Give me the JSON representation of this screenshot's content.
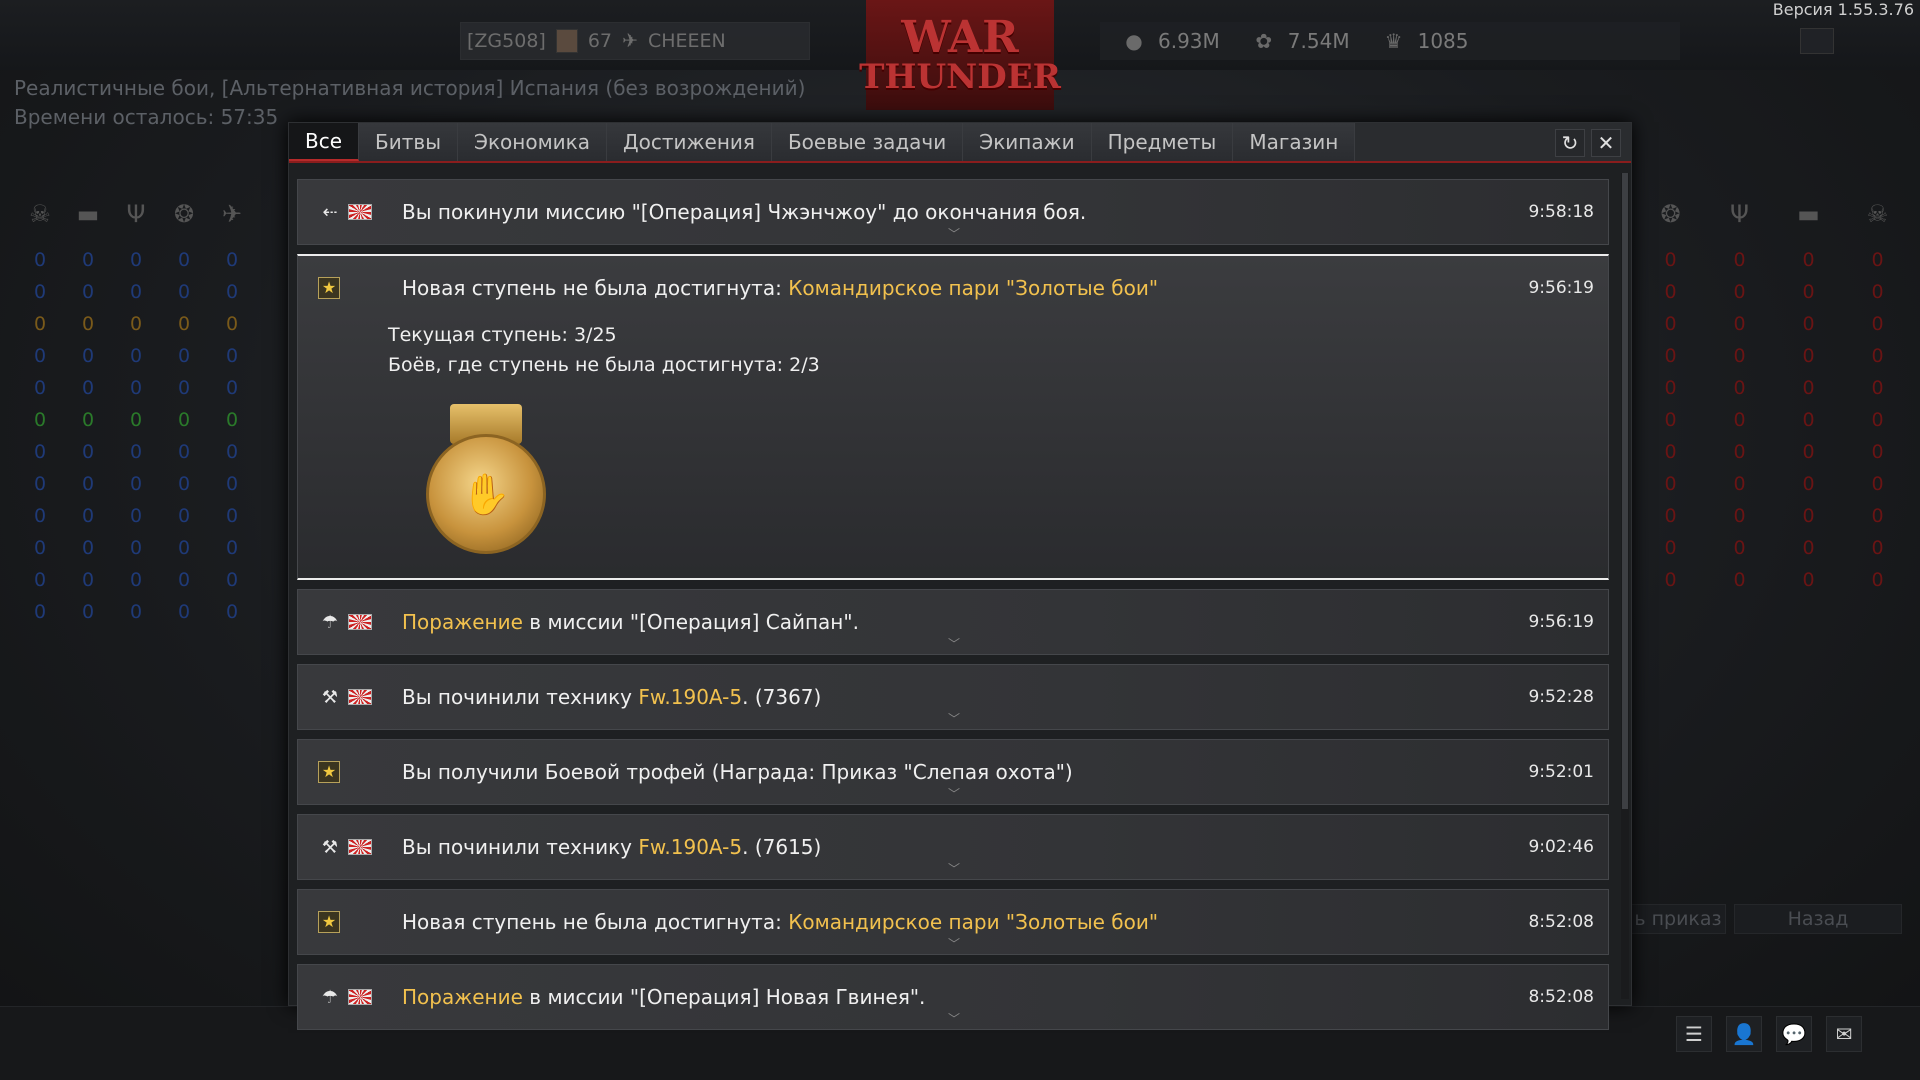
{
  "topbar": {
    "version": "Версия 1.55.3.76",
    "clan_tag": "[ZG508]",
    "level": "67",
    "player_name": "CHEEEN",
    "logo_line1": "WAR",
    "logo_line2": "THUNDER",
    "currencies": [
      {
        "icon": "silver-lions-icon",
        "value": "6.93M"
      },
      {
        "icon": "research-points-icon",
        "value": "7.54M"
      },
      {
        "icon": "golden-eagles-icon",
        "value": "1085"
      }
    ]
  },
  "mission": {
    "line1": "Реалистичные бои, [Альтернативная история]  Испания (без возрождений)",
    "line2": "Времени осталось: 57:35"
  },
  "tabs": [
    "Все",
    "Битвы",
    "Экономика",
    "Достижения",
    "Боевые задачи",
    "Экипажи",
    "Предметы",
    "Магазин"
  ],
  "active_tab": "Все",
  "notifications": [
    {
      "icon": "leave-icon",
      "flag": true,
      "parts": [
        "Вы покинули миссию \"[Операция] Чжэнчжоу\" до окончания боя.",
        "",
        ""
      ],
      "time": "9:58:18"
    },
    {
      "icon": "star-icon",
      "flag": false,
      "parts": [
        "Новая ступень не была достигнута: ",
        "Командирское пари \"Золотые бои\"",
        ""
      ],
      "time": "9:56:19",
      "expanded": true,
      "details": [
        "Текущая ступень: 3/25",
        "Боёв, где ступень не была достигнута: 2/3"
      ]
    },
    {
      "icon": "parachute-icon",
      "flag": true,
      "parts": [
        "",
        "Поражение",
        " в миссии \"[Операция] Сайпан\"."
      ],
      "time": "9:56:19"
    },
    {
      "icon": "wrench-icon",
      "flag": true,
      "parts": [
        "Вы починили технику ",
        "Fw.190A-5",
        ". (7367)"
      ],
      "time": "9:52:28"
    },
    {
      "icon": "star-icon",
      "flag": false,
      "parts": [
        "Вы получили Боевой трофей (Награда: Приказ \"Слепая охота\")",
        "",
        ""
      ],
      "time": "9:52:01"
    },
    {
      "icon": "wrench-icon",
      "flag": true,
      "parts": [
        "Вы починили технику ",
        "Fw.190A-5",
        ". (7615)"
      ],
      "time": "9:02:46"
    },
    {
      "icon": "star-icon",
      "flag": false,
      "parts": [
        "Новая ступень не была достигнута: ",
        "Командирское пари \"Золотые бои\"",
        ""
      ],
      "time": "8:52:08"
    },
    {
      "icon": "parachute-icon",
      "flag": true,
      "parts": [
        "",
        "Поражение",
        " в миссии \"[Операция] Новая Гвинея\"."
      ],
      "time": "8:52:08"
    }
  ],
  "left_scores": [
    [
      "0",
      "0",
      "0",
      "0",
      "0"
    ],
    [
      "0",
      "0",
      "0",
      "0",
      "0"
    ],
    [
      "0",
      "0",
      "0",
      "0",
      "0"
    ],
    [
      "0",
      "0",
      "0",
      "0",
      "0"
    ],
    [
      "0",
      "0",
      "0",
      "0",
      "0"
    ],
    [
      "0",
      "0",
      "0",
      "0",
      "0"
    ],
    [
      "0",
      "0",
      "0",
      "0",
      "0"
    ],
    [
      "0",
      "0",
      "0",
      "0",
      "0"
    ],
    [
      "0",
      "0",
      "0",
      "0",
      "0"
    ],
    [
      "0",
      "0",
      "0",
      "0",
      "0"
    ],
    [
      "0",
      "0",
      "0",
      "0",
      "0"
    ],
    [
      "0",
      "0",
      "0",
      "0",
      "0"
    ]
  ],
  "left_row_colors": [
    "#1f3a78",
    "#1f3a78",
    "#7a5a1a",
    "#1f3a78",
    "#1f3a78",
    "#2a7a2a",
    "#1f3a78",
    "#1f3a78",
    "#1f3a78",
    "#1f3a78",
    "#1f3a78",
    "#1f3a78"
  ],
  "right_scores": [
    [
      "0",
      "0",
      "0",
      "0"
    ],
    [
      "0",
      "0",
      "0",
      "0"
    ],
    [
      "0",
      "0",
      "0",
      "0"
    ],
    [
      "0",
      "0",
      "0",
      "0"
    ],
    [
      "0",
      "0",
      "0",
      "0"
    ],
    [
      "0",
      "0",
      "0",
      "0"
    ],
    [
      "0",
      "0",
      "0",
      "0"
    ],
    [
      "0",
      "0",
      "0",
      "0"
    ],
    [
      "0",
      "0",
      "0",
      "0"
    ],
    [
      "0",
      "0",
      "0",
      "0"
    ],
    [
      "0",
      "0",
      "0",
      "0"
    ]
  ],
  "right_color": "#6a1414",
  "bottom_buttons": [
    "ь приказ",
    "Назад"
  ],
  "bottombar_icons": [
    "list-icon",
    "squad-icon",
    "chat-icon",
    "mail-icon"
  ]
}
